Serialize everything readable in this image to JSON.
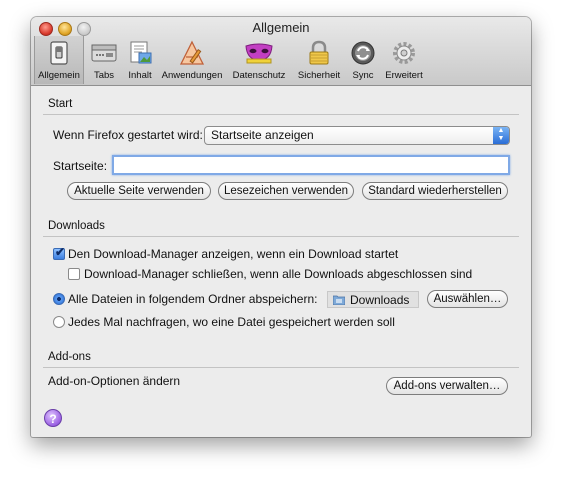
{
  "window": {
    "title": "Allgemein"
  },
  "toolbar": {
    "items": [
      {
        "label": "Allgemein"
      },
      {
        "label": "Tabs"
      },
      {
        "label": "Inhalt"
      },
      {
        "label": "Anwendungen"
      },
      {
        "label": "Datenschutz"
      },
      {
        "label": "Sicherheit"
      },
      {
        "label": "Sync"
      },
      {
        "label": "Erweitert"
      }
    ]
  },
  "start": {
    "section_title": "Start",
    "startup_label": "Wenn Firefox gestartet wird:",
    "startup_value": "Startseite anzeigen",
    "homepage_label": "Startseite:",
    "homepage_value": "",
    "buttons": {
      "use_current": "Aktuelle Seite verwenden",
      "use_bookmark": "Lesezeichen verwenden",
      "restore_default": "Standard wiederherstellen"
    }
  },
  "downloads": {
    "section_title": "Downloads",
    "show_manager_label": "Den Download-Manager anzeigen, wenn ein Download startet",
    "show_manager_checked": true,
    "close_manager_label": "Download-Manager schließen, wenn alle Downloads abgeschlossen sind",
    "close_manager_checked": false,
    "save_to_label": "Alle Dateien in folgendem Ordner abspeichern:",
    "folder_name": "Downloads",
    "choose_button": "Auswählen…",
    "always_ask_label": "Jedes Mal nachfragen, wo eine Datei gespeichert werden soll",
    "selected_option": "save_to"
  },
  "addons": {
    "section_title": "Add-ons",
    "label": "Add-on-Optionen ändern",
    "manage_button": "Add-ons verwalten…"
  },
  "help": {
    "label": "?"
  },
  "colors": {
    "accent": "#3b7ee0",
    "help": "#9b61e3"
  }
}
